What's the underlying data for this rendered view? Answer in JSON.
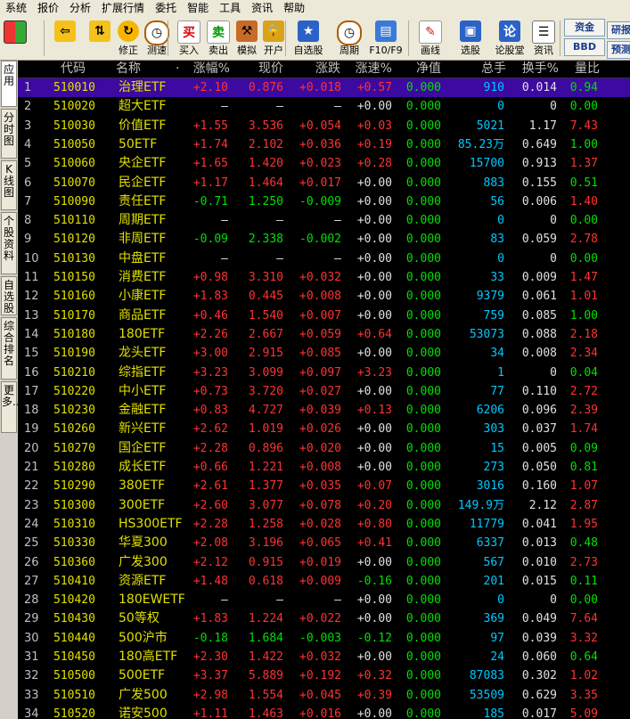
{
  "menu": [
    "系统",
    "报价",
    "分析",
    "扩展行情",
    "委托",
    "智能",
    "工具",
    "资讯",
    "帮助"
  ],
  "toolbar": {
    "buttons": [
      {
        "name": "layout-button",
        "label": "",
        "icon": "grid-icon"
      },
      {
        "name": "back-button",
        "label": "",
        "icon": "back-arrow-icon"
      },
      {
        "name": "up-down-button",
        "label": "",
        "icon": "up-down-arrow-icon"
      },
      {
        "name": "correct-button",
        "label": "修正",
        "icon": "refresh-icon"
      },
      {
        "name": "measure-button",
        "label": "测速",
        "icon": "clock-icon"
      },
      {
        "name": "buy-button",
        "label": "买入",
        "icon": "buy-icon",
        "glyph": "买"
      },
      {
        "name": "sell-button",
        "label": "卖出",
        "icon": "sell-icon",
        "glyph": "卖"
      },
      {
        "name": "simulate-button",
        "label": "模拟",
        "icon": "hammer-icon"
      },
      {
        "name": "open-account-button",
        "label": "开户",
        "icon": "lock-icon"
      },
      {
        "name": "watchlist-button",
        "label": "自选股",
        "icon": "star-icon"
      },
      {
        "name": "period-button",
        "label": "周期",
        "icon": "clock-icon"
      },
      {
        "name": "f10-button",
        "label": "F10/F9",
        "icon": "document-icon"
      },
      {
        "name": "draw-button",
        "label": "画线",
        "icon": "pencil-icon"
      },
      {
        "name": "stock-select-button",
        "label": "选股",
        "icon": "monitor-icon"
      },
      {
        "name": "forum-button",
        "label": "论股堂",
        "icon": "forum-icon",
        "glyph": "论"
      },
      {
        "name": "news-button",
        "label": "资讯",
        "icon": "news-icon"
      }
    ],
    "right_buttons": [
      {
        "name": "funds-button",
        "label": "资金"
      },
      {
        "name": "bbd-button",
        "label": "BBD"
      },
      {
        "name": "research-button",
        "label": "研报"
      },
      {
        "name": "forecast-button",
        "label": "预测"
      }
    ]
  },
  "sidebar_tabs": [
    "应用",
    "分时图",
    "K线图",
    "个股资料",
    "自选股",
    "综合排名",
    "更多.."
  ],
  "columns": [
    "代码",
    "名称",
    "·",
    "涨幅%",
    "现价",
    "涨跌",
    "涨速%",
    "净值",
    "总手",
    "换手%",
    "量比"
  ],
  "rows": [
    {
      "i": "1",
      "code": "510010",
      "name": "治理ETF",
      "chg": "+2.10",
      "price": "0.876",
      "diff": "+0.018",
      "speed": "+0.57",
      "nav": "0.000",
      "vol": "910",
      "turn": "0.014",
      "ratio": "0.94",
      "d": "up",
      "sp": "up",
      "rt": "dn",
      "sel": true
    },
    {
      "i": "2",
      "code": "510020",
      "name": "超大ETF",
      "chg": "—",
      "price": "—",
      "diff": "—",
      "speed": "+0.00",
      "nav": "0.000",
      "vol": "0",
      "turn": "0",
      "ratio": "0.00",
      "d": "flat",
      "sp": "flat",
      "rt": "dn"
    },
    {
      "i": "3",
      "code": "510030",
      "name": "价值ETF",
      "chg": "+1.55",
      "price": "3.536",
      "diff": "+0.054",
      "speed": "+0.03",
      "nav": "0.000",
      "vol": "5021",
      "turn": "1.17",
      "ratio": "7.43",
      "d": "up",
      "sp": "up",
      "rt": "up"
    },
    {
      "i": "4",
      "code": "510050",
      "name": "50ETF",
      "chg": "+1.74",
      "price": "2.102",
      "diff": "+0.036",
      "speed": "+0.19",
      "nav": "0.000",
      "vol": "85.23万",
      "turn": "0.649",
      "ratio": "1.00",
      "d": "up",
      "sp": "up",
      "rt": "dn"
    },
    {
      "i": "5",
      "code": "510060",
      "name": "央企ETF",
      "chg": "+1.65",
      "price": "1.420",
      "diff": "+0.023",
      "speed": "+0.28",
      "nav": "0.000",
      "vol": "15700",
      "turn": "0.913",
      "ratio": "1.37",
      "d": "up",
      "sp": "up",
      "rt": "up"
    },
    {
      "i": "6",
      "code": "510070",
      "name": "民企ETF",
      "chg": "+1.17",
      "price": "1.464",
      "diff": "+0.017",
      "speed": "+0.00",
      "nav": "0.000",
      "vol": "883",
      "turn": "0.155",
      "ratio": "0.51",
      "d": "up",
      "sp": "flat",
      "rt": "dn"
    },
    {
      "i": "7",
      "code": "510090",
      "name": "责任ETF",
      "chg": "-0.71",
      "price": "1.250",
      "diff": "-0.009",
      "speed": "+0.00",
      "nav": "0.000",
      "vol": "56",
      "turn": "0.006",
      "ratio": "1.40",
      "d": "dn",
      "sp": "flat",
      "rt": "up"
    },
    {
      "i": "8",
      "code": "510110",
      "name": "周期ETF",
      "chg": "—",
      "price": "—",
      "diff": "—",
      "speed": "+0.00",
      "nav": "0.000",
      "vol": "0",
      "turn": "0",
      "ratio": "0.00",
      "d": "flat",
      "sp": "flat",
      "rt": "dn"
    },
    {
      "i": "9",
      "code": "510120",
      "name": "非周ETF",
      "chg": "-0.09",
      "price": "2.338",
      "diff": "-0.002",
      "speed": "+0.00",
      "nav": "0.000",
      "vol": "83",
      "turn": "0.059",
      "ratio": "2.78",
      "d": "dn",
      "sp": "flat",
      "rt": "up"
    },
    {
      "i": "10",
      "code": "510130",
      "name": "中盘ETF",
      "chg": "—",
      "price": "—",
      "diff": "—",
      "speed": "+0.00",
      "nav": "0.000",
      "vol": "0",
      "turn": "0",
      "ratio": "0.00",
      "d": "flat",
      "sp": "flat",
      "rt": "dn"
    },
    {
      "i": "11",
      "code": "510150",
      "name": "消费ETF",
      "chg": "+0.98",
      "price": "3.310",
      "diff": "+0.032",
      "speed": "+0.00",
      "nav": "0.000",
      "vol": "33",
      "turn": "0.009",
      "ratio": "1.47",
      "d": "up",
      "sp": "flat",
      "rt": "up"
    },
    {
      "i": "12",
      "code": "510160",
      "name": "小康ETF",
      "chg": "+1.83",
      "price": "0.445",
      "diff": "+0.008",
      "speed": "+0.00",
      "nav": "0.000",
      "vol": "9379",
      "turn": "0.061",
      "ratio": "1.01",
      "d": "up",
      "sp": "flat",
      "rt": "up"
    },
    {
      "i": "13",
      "code": "510170",
      "name": "商品ETF",
      "chg": "+0.46",
      "price": "1.540",
      "diff": "+0.007",
      "speed": "+0.00",
      "nav": "0.000",
      "vol": "759",
      "turn": "0.085",
      "ratio": "1.00",
      "d": "up",
      "sp": "flat",
      "rt": "dn"
    },
    {
      "i": "14",
      "code": "510180",
      "name": "180ETF",
      "chg": "+2.26",
      "price": "2.667",
      "diff": "+0.059",
      "speed": "+0.64",
      "nav": "0.000",
      "vol": "53073",
      "turn": "0.088",
      "ratio": "2.18",
      "d": "up",
      "sp": "up",
      "rt": "up"
    },
    {
      "i": "15",
      "code": "510190",
      "name": "龙头ETF",
      "chg": "+3.00",
      "price": "2.915",
      "diff": "+0.085",
      "speed": "+0.00",
      "nav": "0.000",
      "vol": "34",
      "turn": "0.008",
      "ratio": "2.34",
      "d": "up",
      "sp": "flat",
      "rt": "up"
    },
    {
      "i": "16",
      "code": "510210",
      "name": "综指ETF",
      "chg": "+3.23",
      "price": "3.099",
      "diff": "+0.097",
      "speed": "+3.23",
      "nav": "0.000",
      "vol": "1",
      "turn": "0",
      "ratio": "0.04",
      "d": "up",
      "sp": "up",
      "rt": "dn"
    },
    {
      "i": "17",
      "code": "510220",
      "name": "中小ETF",
      "chg": "+0.73",
      "price": "3.720",
      "diff": "+0.027",
      "speed": "+0.00",
      "nav": "0.000",
      "vol": "77",
      "turn": "0.110",
      "ratio": "2.72",
      "d": "up",
      "sp": "flat",
      "rt": "up"
    },
    {
      "i": "18",
      "code": "510230",
      "name": "金融ETF",
      "chg": "+0.83",
      "price": "4.727",
      "diff": "+0.039",
      "speed": "+0.13",
      "nav": "0.000",
      "vol": "6206",
      "turn": "0.096",
      "ratio": "2.39",
      "d": "up",
      "sp": "up",
      "rt": "up"
    },
    {
      "i": "19",
      "code": "510260",
      "name": "新兴ETF",
      "chg": "+2.62",
      "price": "1.019",
      "diff": "+0.026",
      "speed": "+0.00",
      "nav": "0.000",
      "vol": "303",
      "turn": "0.037",
      "ratio": "1.74",
      "d": "up",
      "sp": "flat",
      "rt": "up"
    },
    {
      "i": "20",
      "code": "510270",
      "name": "国企ETF",
      "chg": "+2.28",
      "price": "0.896",
      "diff": "+0.020",
      "speed": "+0.00",
      "nav": "0.000",
      "vol": "15",
      "turn": "0.005",
      "ratio": "0.09",
      "d": "up",
      "sp": "flat",
      "rt": "dn"
    },
    {
      "i": "21",
      "code": "510280",
      "name": "成长ETF",
      "chg": "+0.66",
      "price": "1.221",
      "diff": "+0.008",
      "speed": "+0.00",
      "nav": "0.000",
      "vol": "273",
      "turn": "0.050",
      "ratio": "0.81",
      "d": "up",
      "sp": "flat",
      "rt": "dn"
    },
    {
      "i": "22",
      "code": "510290",
      "name": "380ETF",
      "chg": "+2.61",
      "price": "1.377",
      "diff": "+0.035",
      "speed": "+0.07",
      "nav": "0.000",
      "vol": "3016",
      "turn": "0.160",
      "ratio": "1.07",
      "d": "up",
      "sp": "up",
      "rt": "up"
    },
    {
      "i": "23",
      "code": "510300",
      "name": "300ETF",
      "chg": "+2.60",
      "price": "3.077",
      "diff": "+0.078",
      "speed": "+0.20",
      "nav": "0.000",
      "vol": "149.9万",
      "turn": "2.12",
      "ratio": "2.87",
      "d": "up",
      "sp": "up",
      "rt": "up"
    },
    {
      "i": "24",
      "code": "510310",
      "name": "HS300ETF",
      "chg": "+2.28",
      "price": "1.258",
      "diff": "+0.028",
      "speed": "+0.80",
      "nav": "0.000",
      "vol": "11779",
      "turn": "0.041",
      "ratio": "1.95",
      "d": "up",
      "sp": "up",
      "rt": "up"
    },
    {
      "i": "25",
      "code": "510330",
      "name": "华夏300",
      "chg": "+2.08",
      "price": "3.196",
      "diff": "+0.065",
      "speed": "+0.41",
      "nav": "0.000",
      "vol": "6337",
      "turn": "0.013",
      "ratio": "0.48",
      "d": "up",
      "sp": "up",
      "rt": "dn"
    },
    {
      "i": "26",
      "code": "510360",
      "name": "广发300",
      "chg": "+2.12",
      "price": "0.915",
      "diff": "+0.019",
      "speed": "+0.00",
      "nav": "0.000",
      "vol": "567",
      "turn": "0.010",
      "ratio": "2.73",
      "d": "up",
      "sp": "flat",
      "rt": "up"
    },
    {
      "i": "27",
      "code": "510410",
      "name": "资源ETF",
      "chg": "+1.48",
      "price": "0.618",
      "diff": "+0.009",
      "speed": "-0.16",
      "nav": "0.000",
      "vol": "201",
      "turn": "0.015",
      "ratio": "0.11",
      "d": "up",
      "sp": "dn",
      "rt": "dn"
    },
    {
      "i": "28",
      "code": "510420",
      "name": "180EWETF",
      "chg": "—",
      "price": "—",
      "diff": "—",
      "speed": "+0.00",
      "nav": "0.000",
      "vol": "0",
      "turn": "0",
      "ratio": "0.00",
      "d": "flat",
      "sp": "flat",
      "rt": "dn"
    },
    {
      "i": "29",
      "code": "510430",
      "name": "50等权",
      "chg": "+1.83",
      "price": "1.224",
      "diff": "+0.022",
      "speed": "+0.00",
      "nav": "0.000",
      "vol": "369",
      "turn": "0.049",
      "ratio": "7.64",
      "d": "up",
      "sp": "flat",
      "rt": "up"
    },
    {
      "i": "30",
      "code": "510440",
      "name": "500沪市",
      "chg": "-0.18",
      "price": "1.684",
      "diff": "-0.003",
      "speed": "-0.12",
      "nav": "0.000",
      "vol": "97",
      "turn": "0.039",
      "ratio": "3.32",
      "d": "dn",
      "sp": "dn",
      "rt": "up"
    },
    {
      "i": "31",
      "code": "510450",
      "name": "180高ETF",
      "chg": "+2.30",
      "price": "1.422",
      "diff": "+0.032",
      "speed": "+0.00",
      "nav": "0.000",
      "vol": "24",
      "turn": "0.060",
      "ratio": "0.64",
      "d": "up",
      "sp": "flat",
      "rt": "dn"
    },
    {
      "i": "32",
      "code": "510500",
      "name": "500ETF",
      "chg": "+3.37",
      "price": "5.889",
      "diff": "+0.192",
      "speed": "+0.32",
      "nav": "0.000",
      "vol": "87083",
      "turn": "0.302",
      "ratio": "1.02",
      "d": "up",
      "sp": "up",
      "rt": "up"
    },
    {
      "i": "33",
      "code": "510510",
      "name": "广发500",
      "chg": "+2.98",
      "price": "1.554",
      "diff": "+0.045",
      "speed": "+0.39",
      "nav": "0.000",
      "vol": "53509",
      "turn": "0.629",
      "ratio": "3.35",
      "d": "up",
      "sp": "up",
      "rt": "up"
    },
    {
      "i": "34",
      "code": "510520",
      "name": "诺安500",
      "chg": "+1.11",
      "price": "1.463",
      "diff": "+0.016",
      "speed": "+0.00",
      "nav": "0.000",
      "vol": "185",
      "turn": "0.017",
      "ratio": "5.09",
      "d": "up",
      "sp": "flat",
      "rt": "up"
    }
  ]
}
